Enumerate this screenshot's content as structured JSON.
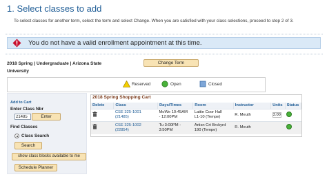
{
  "step": {
    "title": "1.  Select classes to add"
  },
  "instructions": "To select classes for another term, select the term and select Change.  When you are satisfied with your class selections, proceed to step 2 of 3.",
  "alert": {
    "message": "You do not have a valid enrollment appointment at this time."
  },
  "term": {
    "label": "2018 Spring | Undergraduate | Arizona State University",
    "change_button": "Change Term"
  },
  "legend": {
    "reserved": "Reserved",
    "open": "Open",
    "closed": "Closed"
  },
  "add_to_cart": {
    "title": "Add to Cart",
    "enter_class_nbr_label": "Enter Class Nbr",
    "class_nbr_value": "21485",
    "enter_button": "Enter",
    "find_classes_label": "Find Classes",
    "class_search_option": "Class Search",
    "search_button": "Search",
    "show_blocks_button": "show class blocks available to me",
    "schedule_planner_button": "Schedule Planner"
  },
  "cart": {
    "title": "2018 Spring Shopping Cart",
    "columns": [
      "Delete",
      "Class",
      "Days/Times",
      "Room",
      "Instructor",
      "Units",
      "Status"
    ],
    "rows": [
      {
        "class_line1": "CSE 325-1001",
        "class_line2": "(21485)",
        "days_line1": "MoWe 10:45AM",
        "days_line2": "- 12:00PM",
        "room_line1": "Lattie Coor Hall",
        "room_line2": "L1-10 (Tempe)",
        "instructor": "R. Meuth",
        "units": "3.00",
        "status": "Open"
      },
      {
        "class_line1": "CSE 325-1002",
        "class_line2": "(22854)",
        "days_line1": "Tu 3:00PM -",
        "days_line2": "3:50PM",
        "room_line1": "Artisn Crt Brckyrd",
        "room_line2": "190 (Tempe)",
        "instructor": "R. Meuth",
        "units": "",
        "status": "Open"
      }
    ]
  },
  "colors": {
    "accent": "#1f5d96",
    "alert_bg": "#dae9f7",
    "button_bg": "#f8e3b4",
    "open_green": "#49b23a"
  }
}
